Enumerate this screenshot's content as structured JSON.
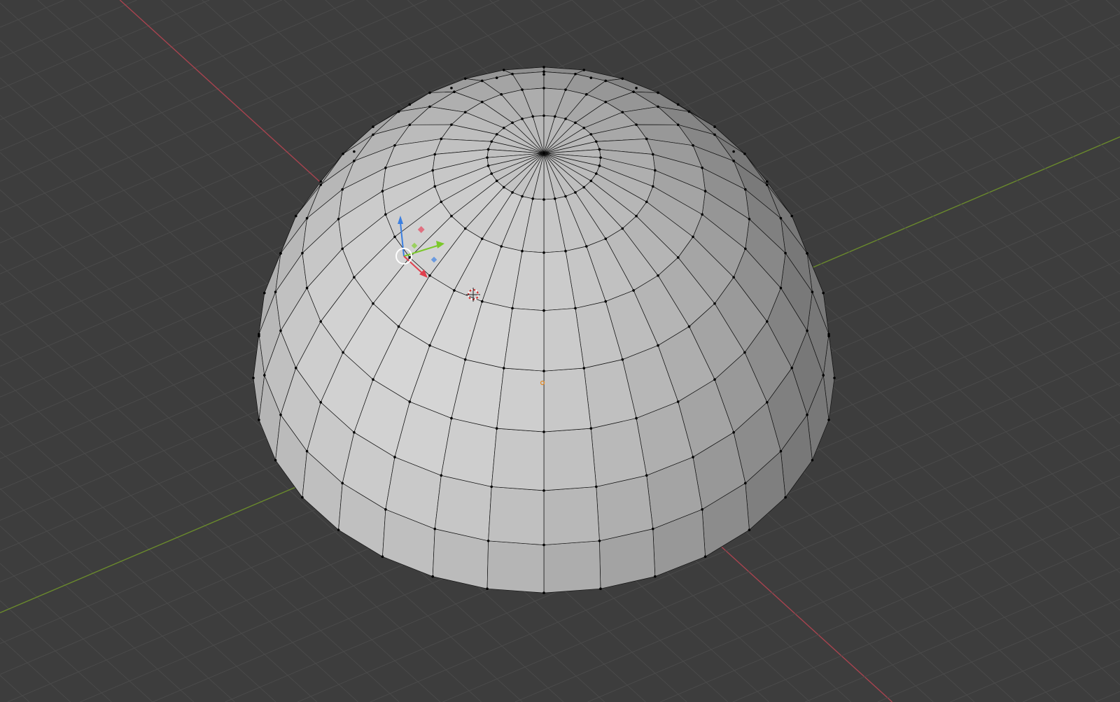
{
  "viewport": {
    "background": "#3d3d3d",
    "grid_color": "#4a4a4a",
    "x_axis_color": "#a8434f",
    "y_axis_color": "#6a8a2c",
    "mesh_color": "#b4b4b4",
    "edge_color": "#111111",
    "origin_color": "#e08a2a"
  },
  "mesh": {
    "type": "uv-hemisphere",
    "segments": 32,
    "rings": 8
  },
  "icons": {
    "transform_gizmo": "transform-gizmo-icon",
    "cursor": "3d-cursor-icon",
    "origin": "object-origin-icon"
  }
}
